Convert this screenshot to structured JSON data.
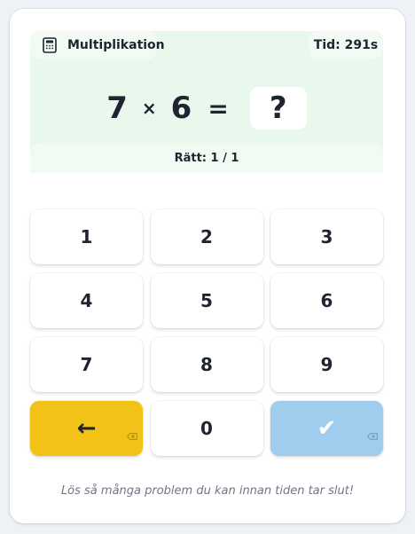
{
  "header": {
    "mode_label": "Multiplikation",
    "mode_icon": "calculator-icon",
    "time_label": "Tid: 291s"
  },
  "problem": {
    "left": "7",
    "operator": "×",
    "right": "6",
    "equals": "=",
    "answer": "?"
  },
  "score": {
    "label": "Rätt: 1 / 1"
  },
  "keypad": {
    "keys": [
      "1",
      "2",
      "3",
      "4",
      "5",
      "6",
      "7",
      "8",
      "9"
    ],
    "back": "←",
    "zero": "0",
    "submit": "✔"
  },
  "footer": {
    "hint": "Lös så många problem du kan innan tiden tar slut!"
  },
  "colors": {
    "backspace": "#f2c316",
    "submit": "#a0ccee",
    "top_area": "#e8f8ec"
  }
}
